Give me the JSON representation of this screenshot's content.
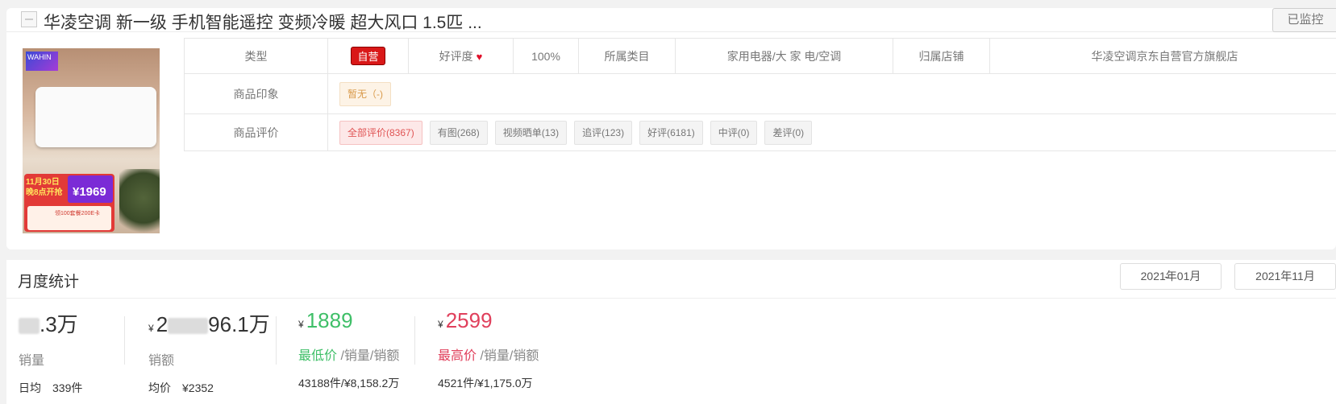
{
  "product": {
    "title": "华凌空调 新一级 手机智能遥控 变频冷暖 超大风口 1.5匹 ...",
    "monitor_label": "已监控",
    "image": {
      "brand_logo_text": "WAHIN",
      "promo_date_text": "11月30日 晚8点开抢",
      "promo_price": "¥1969",
      "promo_coupon_text": "领100套餐200E卡",
      "icon": "product-photo"
    }
  },
  "info": {
    "type_label": "类型",
    "type_value": "自营",
    "rating_label": "好评度",
    "rating_value": "100%",
    "category_label": "所属类目",
    "category_value": "家用电器/大 家 电/空调",
    "shop_label": "归属店铺",
    "shop_value": "华凌空调京东自营官方旗舰店",
    "impression_label": "商品印象",
    "impression_value": "暂无（-)",
    "review_label": "商品评价",
    "review_chips": [
      "全部评价(8367)",
      "有图(268)",
      "视频晒单(13)",
      "追评(123)",
      "好评(6181)",
      "中评(0)",
      "差评(0)"
    ]
  },
  "monthly": {
    "title": "月度统计",
    "date_from": "2021年01月",
    "date_sep": "-",
    "date_to": "2021年11月",
    "sales": {
      "value_suffix": ".3万",
      "label": "销量",
      "sub_key": "日均",
      "sub_value": "339件"
    },
    "revenue": {
      "currency": "¥",
      "value_prefix": "2",
      "value_suffix": "96.1万",
      "label": "销额",
      "sub_key": "均价",
      "sub_value": "¥2352"
    },
    "min_price": {
      "currency": "¥",
      "value": "1889",
      "label": "最低价",
      "label_suffix": " /销量/销额",
      "sub": "43188件/¥8,158.2万"
    },
    "max_price": {
      "currency": "¥",
      "value": "2599",
      "label": "最高价",
      "label_suffix": " /销量/销额",
      "sub": "4521件/¥1,175.0万"
    }
  },
  "colors": {
    "self_tag": "#d91818",
    "min_price": "#3fbf68",
    "max_price": "#e0405c"
  }
}
